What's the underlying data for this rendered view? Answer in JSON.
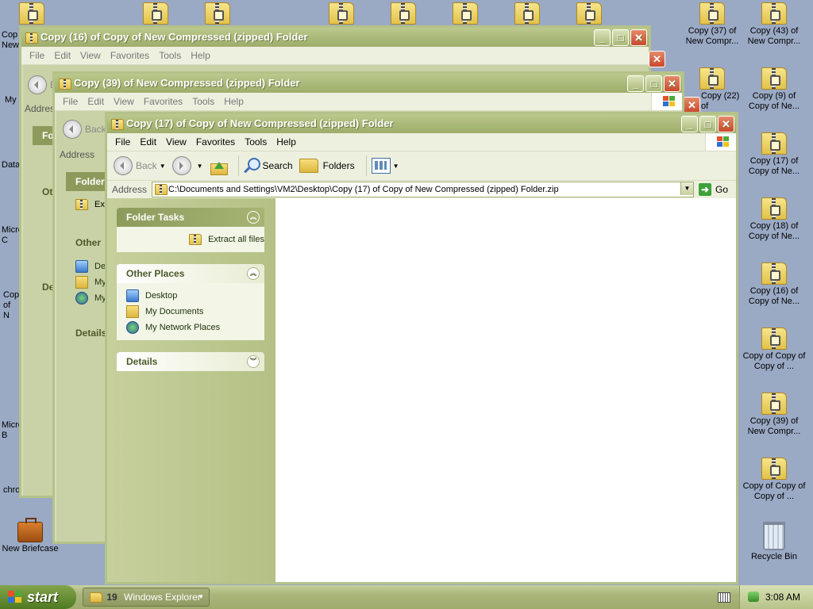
{
  "desktop": {
    "icons": [
      {
        "id": "d1",
        "label": "Copy (37) of New Compr..."
      },
      {
        "id": "d2",
        "label": "Copy (43) of New Compr..."
      },
      {
        "id": "d3",
        "label": "Copy (22) of"
      },
      {
        "id": "d4",
        "label": "Copy (9) of Copy of Ne..."
      },
      {
        "id": "d5",
        "label": "Copy (17) of Copy of Ne..."
      },
      {
        "id": "d6",
        "label": "Copy (18) of Copy of Ne..."
      },
      {
        "id": "d7",
        "label": "Copy (16) of Copy of Ne..."
      },
      {
        "id": "d8",
        "label": "Copy of Copy of Copy of ..."
      },
      {
        "id": "d9",
        "label": "Copy (39) of New Compr..."
      },
      {
        "id": "d10",
        "label": "Copy of Copy of Copy of ..."
      },
      {
        "id": "d11",
        "label": "Recycle Bin"
      },
      {
        "id": "d12",
        "label": "New Briefcase"
      },
      {
        "id": "l1",
        "label": "Cop New"
      },
      {
        "id": "l2",
        "label": "My"
      },
      {
        "id": "l3",
        "label": "Data"
      },
      {
        "id": "l4",
        "label": "Micro C"
      },
      {
        "id": "l5",
        "label": "Cop of N"
      },
      {
        "id": "l6",
        "label": "Micro B"
      },
      {
        "id": "l7",
        "label": "chro"
      }
    ]
  },
  "back_window_1": {
    "title": "Copy (16) of Copy of New Compressed (zipped) Folder",
    "menu": [
      "File",
      "Edit",
      "View",
      "Favorites",
      "Tools",
      "Help"
    ],
    "address_label": "Address",
    "back_label": "B",
    "tasks_head": "Fo",
    "other_head": "Oth",
    "details_head": "De"
  },
  "back_window_2": {
    "title": "Copy (39) of New Compressed (zipped) Folder",
    "menu": [
      "File",
      "Edit",
      "View",
      "Favorites",
      "Tools",
      "Help"
    ],
    "back_label": "Back",
    "address_label": "Address",
    "tasks_head": "Folder",
    "extract_label": "Ext",
    "other_head": "Other",
    "other_items": [
      "De",
      "My",
      "My"
    ],
    "details_head": "Details"
  },
  "main_window": {
    "title": "Copy (17) of Copy of New Compressed (zipped) Folder",
    "menu": [
      "File",
      "Edit",
      "View",
      "Favorites",
      "Tools",
      "Help"
    ],
    "toolbar": {
      "back": "Back",
      "search": "Search",
      "folders": "Folders"
    },
    "address": {
      "label": "Address",
      "value": "C:\\Documents and Settings\\VM2\\Desktop\\Copy (17) of Copy of New Compressed (zipped) Folder.zip",
      "go": "Go"
    },
    "folder_tasks": {
      "title": "Folder Tasks",
      "items": [
        "Extract all files"
      ]
    },
    "other_places": {
      "title": "Other Places",
      "items": [
        "Desktop",
        "My Documents",
        "My Network Places"
      ]
    },
    "details": {
      "title": "Details"
    }
  },
  "taskbar": {
    "start": "start",
    "task_count": "19",
    "task_label": "Windows Explorer",
    "clock": "3:08 AM"
  },
  "colors": {
    "desktop": "#9aa9c4",
    "title_olive": "#a7b776",
    "task_pane": "#c7d09d",
    "start_green": "#4f7a22"
  }
}
